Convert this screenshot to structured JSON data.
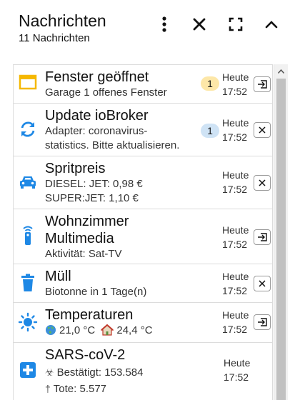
{
  "header": {
    "title": "Nachrichten",
    "subtitle": "11 Nachrichten"
  },
  "colors": {
    "yellow": "#f5b800",
    "blue": "#1e88e5",
    "badge_yellow": "#fde7a8",
    "badge_blue": "#cfe3f5"
  },
  "messages": [
    {
      "title": "Fenster geöffnet",
      "body": "Garage 1 offenes Fenster",
      "icon": "window-icon",
      "badge": "1",
      "badge_color": "yellow",
      "time_day": "Heute",
      "time_clock": "17:52",
      "action": "open-icon"
    },
    {
      "title": "Update ioBroker",
      "body_line1": "Adapter: coronavirus-",
      "body_line2": "statistics. Bitte aktualisieren.",
      "icon": "sync-icon",
      "badge": "1",
      "badge_color": "blue",
      "time_day": "Heute",
      "time_clock": "17:52",
      "action": "close-icon"
    },
    {
      "title": "Spritpreis",
      "body_line1": "DIESEL: JET: 0,98 €",
      "body_line2": "SUPER:JET: 1,10 €",
      "icon": "car-icon",
      "time_day": "Heute",
      "time_clock": "17:52",
      "action": "close-icon"
    },
    {
      "title_line1": "Wohnzimmer",
      "title_line2": "Multimedia",
      "body": "Aktivität: Sat-TV",
      "icon": "remote-icon",
      "time_day": "Heute",
      "time_clock": "17:52",
      "action": "open-icon"
    },
    {
      "title": "Müll",
      "body": "Biotonne in 1 Tage(n)",
      "icon": "trash-icon",
      "time_day": "Heute",
      "time_clock": "17:52",
      "action": "close-icon"
    },
    {
      "title": "Temperaturen",
      "outside": "21,0 °C",
      "inside": "24,4 °C",
      "icon": "sun-icon",
      "time_day": "Heute",
      "time_clock": "17:52",
      "action": "open-icon"
    },
    {
      "title": "SARS-coV-2",
      "confirmed": "Bestätigt: 153.584",
      "deaths": "Tote: 5.577",
      "icon": "medical-cross-icon",
      "time_day": "Heute",
      "time_clock": "17:52"
    }
  ]
}
